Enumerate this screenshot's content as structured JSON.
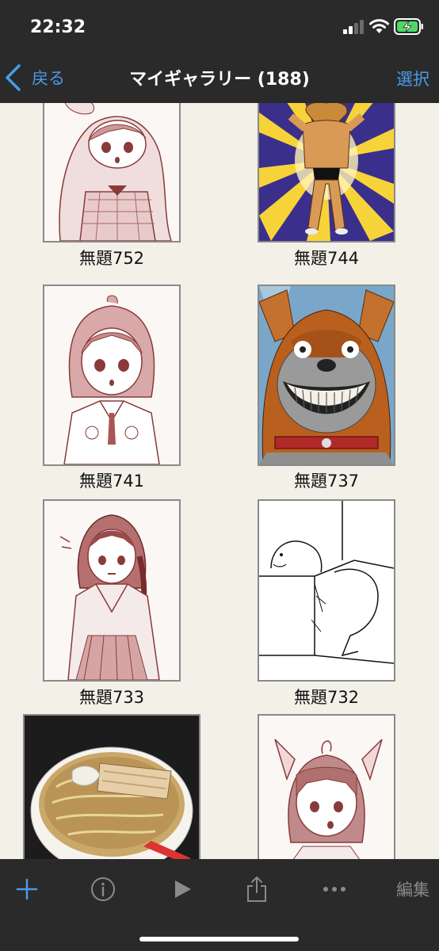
{
  "status_bar": {
    "time": "22:32"
  },
  "nav": {
    "back_label": "戻る",
    "title": "マイギャラリー (188)",
    "select_label": "選択"
  },
  "gallery": {
    "items": [
      {
        "title": "無題752",
        "thumbnail": "anime-girl-plaid-sketch"
      },
      {
        "title": "無題744",
        "thumbnail": "muscular-dog-sunburst"
      },
      {
        "title": "無題741",
        "thumbnail": "anime-girl-uniform-sketch"
      },
      {
        "title": "無題737",
        "thumbnail": "grinning-dog-painting"
      },
      {
        "title": "無題733",
        "thumbnail": "anime-girl-braid-sketch"
      },
      {
        "title": "無題732",
        "thumbnail": "seal-line-comic"
      },
      {
        "title": "",
        "thumbnail": "ramen-bowl-painting"
      },
      {
        "title": "",
        "thumbnail": "anime-girl-bow-sketch"
      }
    ]
  },
  "toolbar": {
    "add_icon": "plus-icon",
    "info_icon": "info-icon",
    "play_icon": "play-icon",
    "share_icon": "share-icon",
    "more_icon": "more-icon",
    "edit_label": "編集"
  },
  "colors": {
    "bar_background": "#2a2a2a",
    "accent": "#4a9be8",
    "page_background": "#f2f0e7",
    "sketch_ink": "#8a3a3a"
  }
}
